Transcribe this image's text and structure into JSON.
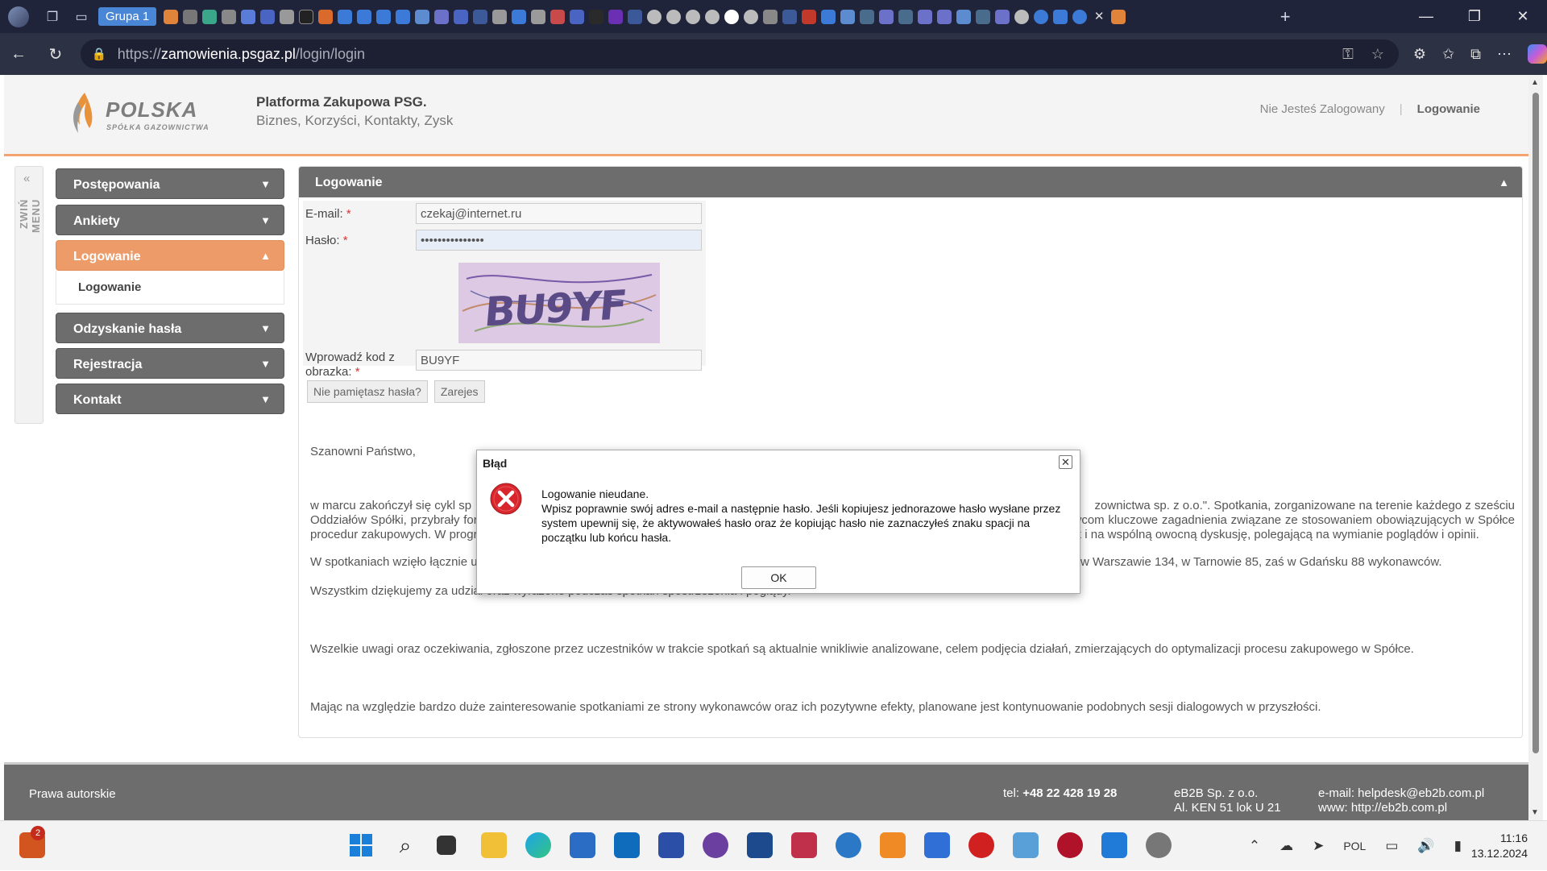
{
  "browser": {
    "group_label": "Grupa 1",
    "url_host": "zamowienia.psgaz.pl",
    "url_path": "/login/login",
    "url_scheme": "https://"
  },
  "site": {
    "logo_text": "POLSKA",
    "logo_sub": "SPÓŁKA GAZOWNICTWA",
    "platform_title": "Platforma Zakupowa PSG.",
    "platform_subtitle": "Biznes, Korzyści, Kontakty, Zysk",
    "not_logged": "Nie Jesteś Zalogowany",
    "login_link": "Logowanie",
    "collapse_label": "ZWIŃ MENU"
  },
  "menu": {
    "items": [
      {
        "label": "Postępowania"
      },
      {
        "label": "Ankiety"
      },
      {
        "label": "Logowanie"
      },
      {
        "label": "Odzyskanie hasła"
      },
      {
        "label": "Rejestracja"
      },
      {
        "label": "Kontakt"
      }
    ],
    "sub_item": "Logowanie"
  },
  "panel": {
    "title": "Logowanie",
    "email_label": "E-mail:",
    "email_value": "czekaj@internet.ru",
    "password_label": "Hasło:",
    "password_value": "•••••••••••••••",
    "captcha_text": "BU9YF",
    "captcha_label_1": "Wprowadź kod z",
    "captcha_label_2": "obrazka:",
    "captcha_value": "BU9YF",
    "forgot_button": "Nie pamiętasz hasła?",
    "register_button": "Zarejes"
  },
  "content": {
    "greeting": "Szanowni Państwo,",
    "p1_line1_left": "w marcu zakończył się cykl sp",
    "p1_line1_right": "zownictwa sp. z o.o.\". Spotkania, zorganizowane na terenie każdego z sześciu",
    "p1_rest": "Oddziałów Spółki, przybrały formę sesji dialogowych, podczas których Dyrektor Departamentu Zakupów Katarzyna Mikuta wyjaśniała wykonawcom kluczowe zagadnienia związane ze stosowaniem obowiązujących w Spółce procedur zakupowych. W programie konferencji znalazło się także miejsce na omówienie uwag dotychczas zgłaszanych przez wykonawców, jak i na wspólną owocną dyskusję, polegającą na wymianie poglądów i opinii.",
    "p2": "W spotkaniach wzięło łącznie udział 668 wykonawców, w tym w poszczególnych Oddziałach: w Poznaniu 131, we Wrocławiu 60, w Zabrzu 170, w Warszawie 134, w Tarnowie 85, zaś w Gdańsku 88 wykonawców.",
    "p3": "Wszystkim dziękujemy za udział oraz wyrażone podczas spotkań spostrzeżenia i poglądy.",
    "p4": "Wszelkie uwagi oraz oczekiwania, zgłoszone przez uczestników w trakcie spotkań są aktualnie wnikliwie analizowane, celem podjęcia działań, zmierzających do optymalizacji procesu zakupowego w Spółce.",
    "p5": "Mając na względzie bardzo duże zainteresowanie spotkaniami ze strony wykonawców oraz ich pozytywne efekty, planowane jest kontynuowanie podobnych sesji dialogowych w przyszłości."
  },
  "footer": {
    "copyright": "Prawa autorskie",
    "tel_label": "tel: ",
    "tel_value": "+48 22 428 19 28",
    "company": "eB2B Sp. z o.o.",
    "address": "Al. KEN 51 lok U 21",
    "email": "e-mail: helpdesk@eb2b.com.pl",
    "www": "www: http://eb2b.com.pl"
  },
  "dialog": {
    "title": "Błąd",
    "line1": "Logowanie nieudane.",
    "line2": "Wpisz poprawnie swój adres e-mail a następnie hasło. Jeśli kopiujesz jednorazowe hasło wysłane przez system upewnij się, że aktywowałeś hasło oraz że kopiując hasło nie zaznaczyłeś znaku spacji na początku lub końcu hasła.",
    "ok": "OK"
  },
  "taskbar": {
    "lang": "POL",
    "time": "11:16",
    "date": "13.12.2024",
    "badge": "2"
  },
  "colors": {
    "accent": "#ec9b69",
    "menu_bg": "#6d6d6d",
    "error": "#d9262c"
  }
}
